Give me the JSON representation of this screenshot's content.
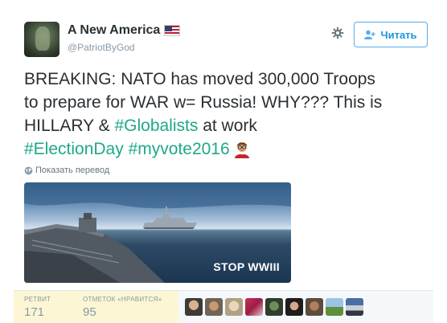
{
  "user": {
    "name": "A New America",
    "handle": "@PatriotByGod",
    "flag_icon": "us-flag-icon"
  },
  "actions": {
    "settings_icon": "gear-icon",
    "follow_label": "Читать",
    "follow_icon": "add-user-icon"
  },
  "tweet": {
    "line1": "BREAKING: NATO has moved 300,000 Troops",
    "line2": "to prepare for WAR w= Russia! WHY??? This is",
    "line3_prefix": "HILLARY & ",
    "hashtag_globalists": "#Globalists",
    "line3_suffix": " at work",
    "hashtag_electionday": "#ElectionDay",
    "hashtag_myvote": "#myvote2016",
    "emoji": "man-with-glasses-emoji",
    "highlight_color": "#1ea889"
  },
  "translate": {
    "label": "Показать перевод",
    "icon": "globe-icon"
  },
  "media": {
    "overlay_text": "STOP WWIII"
  },
  "stats": {
    "retweets_label": "РЕТВИТ",
    "retweets_value": "171",
    "likes_label": "ОТМЕТОК «НРАВИТСЯ»",
    "likes_value": "95",
    "liker_avatar_count": 9
  }
}
